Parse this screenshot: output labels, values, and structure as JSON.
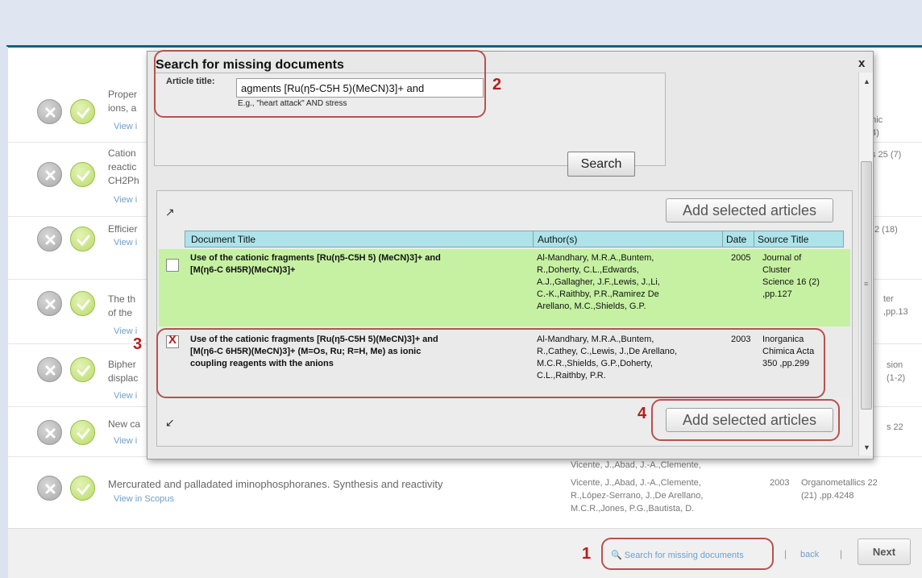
{
  "background": {
    "rows": [
      {
        "title_lines": [
          "Proper",
          "ions, a"
        ],
        "link": "View i",
        "right_lines": [
          "anic",
          "24)"
        ]
      },
      {
        "title_lines": [
          "Cation",
          "reactic",
          "CH2Ph"
        ],
        "link": "View i",
        "right_lines": [
          "s 25 (7)"
        ]
      },
      {
        "title_lines": [
          "Efficier"
        ],
        "link": "View i",
        "right_lines": [
          "2 (18)"
        ]
      },
      {
        "title_lines": [
          "The th",
          "of the"
        ],
        "link": "View i",
        "right_lines": [
          "ter",
          ",pp.13"
        ]
      },
      {
        "title_lines": [
          "Bipher",
          "displac"
        ],
        "link": "View i",
        "right_lines": [
          "sion",
          "(1-2)"
        ]
      },
      {
        "title_lines": [
          "New ca"
        ],
        "link": "View i",
        "right_lines": [
          "s 22"
        ]
      }
    ],
    "full_row": {
      "title": "Mercurated and palladated iminophosphoranes. Synthesis and reactivity",
      "link": "View in Scopus",
      "authors": [
        "Vicente, J.,Abad, J.-A.,Clemente,",
        "R.,López-Serrano, J.,De Arellano,",
        "M.C.R.,Jones, P.G.,Bautista, D."
      ],
      "year": "2003",
      "source": [
        "Organometallics 22",
        "(21) ,pp.4248"
      ]
    },
    "partial_author_line": "Vicente, J.,Abad, J.-A.,Clemente,"
  },
  "pager": {
    "missing_link": "Search for missing documents",
    "sep": "|",
    "back": "back",
    "next": "Next"
  },
  "modal": {
    "title": "Search for missing documents",
    "close": "x",
    "article_label": "Article title:",
    "article_value": "agments [Ru(η5-C5H 5)(MeCN)3]+ and",
    "hint": "E.g., \"heart attack\" AND stress",
    "search_button": "Search",
    "add_selected": "Add selected articles",
    "columns": {
      "title": "Document Title",
      "authors": "Author(s)",
      "date": "Date",
      "source": "Source Title"
    },
    "results": [
      {
        "checked": "",
        "title_lines": [
          "Use of the cationic fragments [Ru(η5-C5H 5) (MeCN)3]+ and",
          "[M(η6-C 6H5R)(MeCN)3]+"
        ],
        "author_lines": [
          "Al-Mandhary, M.R.A.,Buntem,",
          "R.,Doherty, C.L.,Edwards,",
          "A.J.,Gallagher, J.F.,Lewis, J.,Li,",
          "C.-K.,Raithby, P.R.,Ramirez De",
          "Arellano, M.C.,Shields, G.P."
        ],
        "date": "2005",
        "source_lines": [
          "Journal of",
          "Cluster",
          "Science 16 (2)",
          ",pp.127"
        ]
      },
      {
        "checked": "X",
        "title_lines": [
          "Use of the cationic fragments [Ru(η5-C5H 5)(MeCN)3]+ and",
          "[M(η6-C 6H5R)(MeCN)3]+ (M=Os, Ru; R=H, Me) as ionic",
          "coupling reagents with the anions"
        ],
        "author_lines": [
          "Al-Mandhary, M.R.A.,Buntem,",
          "R.,Cathey, C.,Lewis, J.,De Arellano,",
          "M.C.R.,Shields, G.P.,Doherty,",
          "C.L.,Raithby, P.R."
        ],
        "date": "2003",
        "source_lines": [
          "Inorganica",
          "Chimica Acta",
          "350 ,pp.299"
        ]
      }
    ]
  },
  "annotations": [
    "1",
    "2",
    "3",
    "4"
  ],
  "colors": {
    "accent": "#1d5f7d",
    "annotation": "#b8514e",
    "selected_row": "#c6f1a3",
    "header": "#aee3ea"
  }
}
